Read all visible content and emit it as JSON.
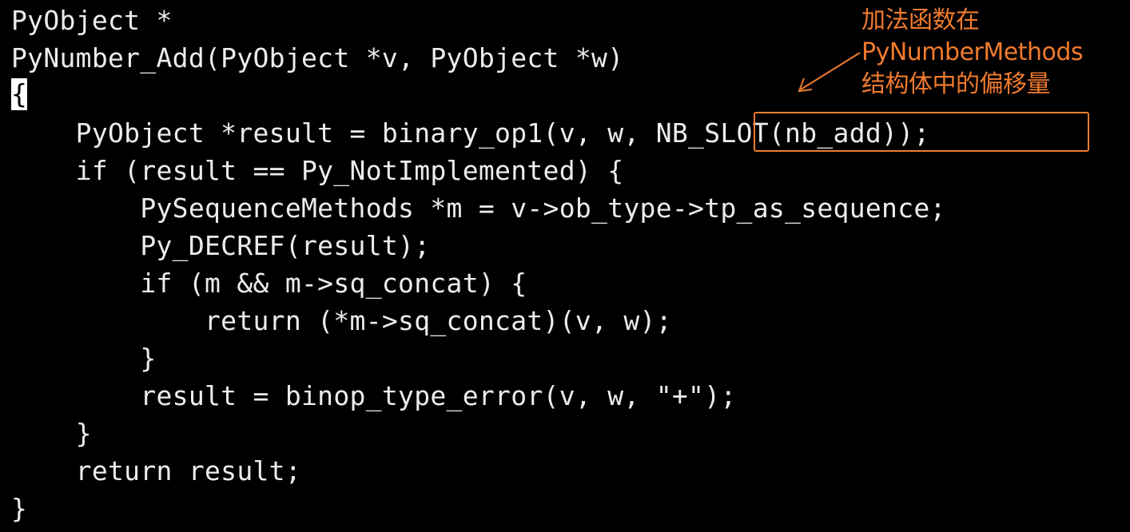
{
  "code": {
    "lines": [
      "PyObject *",
      "PyNumber_Add(PyObject *v, PyObject *w)",
      "{",
      "    PyObject *result = binary_op1(v, w, NB_SLOT(nb_add));",
      "    if (result == Py_NotImplemented) {",
      "        PySequenceMethods *m = v->ob_type->tp_as_sequence;",
      "        Py_DECREF(result);",
      "        if (m && m->sq_concat) {",
      "            return (*m->sq_concat)(v, w);",
      "        }",
      "        result = binop_type_error(v, w, \"+\");",
      "    }",
      "    return result;",
      "}"
    ],
    "highlighted_text": "NB_SLOT(nb_add));"
  },
  "annotation": {
    "lines": [
      "加法函数在",
      "PyNumberMethods",
      "结构体中的偏移量"
    ],
    "color": "#f07b2f"
  },
  "theme": {
    "background": "#000000",
    "text": "#ececec",
    "accent": "#f07b2f"
  }
}
